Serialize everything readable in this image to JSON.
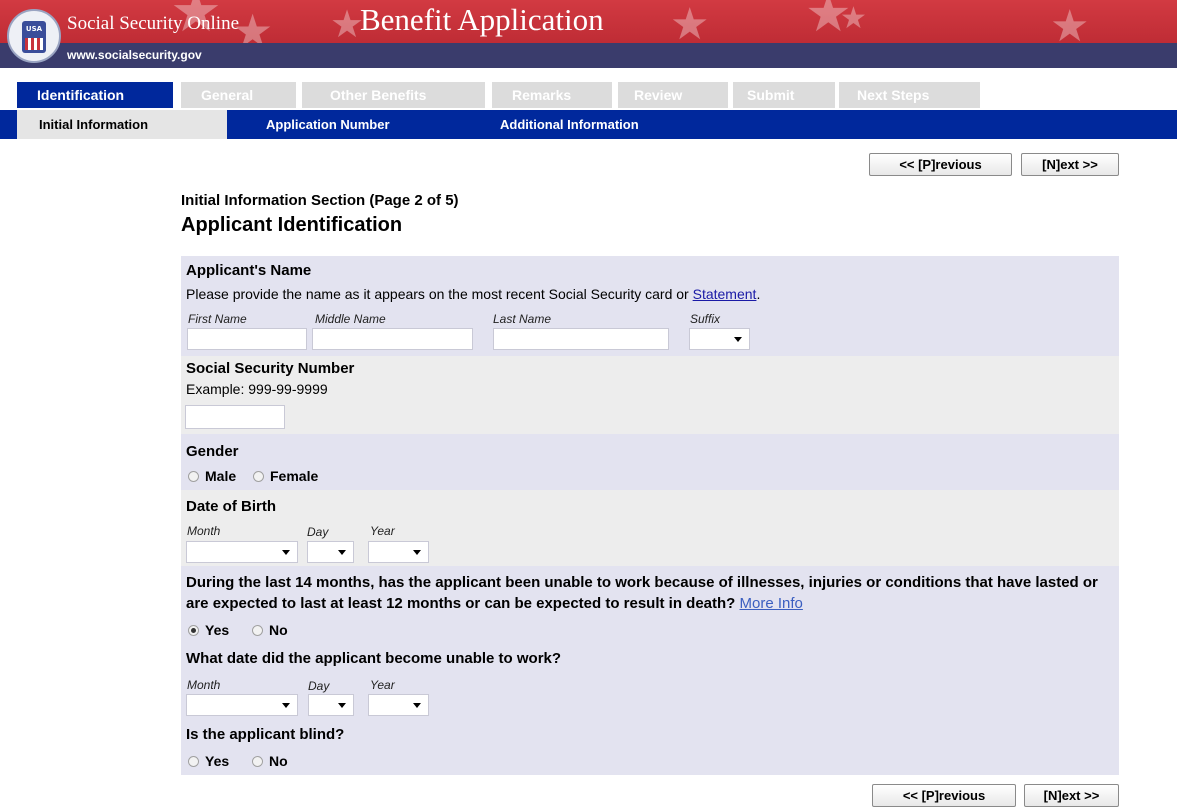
{
  "header": {
    "site_name": "Social Security Online",
    "site_url": "www.socialsecurity.gov",
    "app_title": "Benefit Application",
    "seal_text": "USA"
  },
  "tabs": [
    {
      "label": "Identification",
      "active": true
    },
    {
      "label": "General",
      "active": false
    },
    {
      "label": "Other Benefits",
      "active": false
    },
    {
      "label": "Remarks",
      "active": false
    },
    {
      "label": "Review",
      "active": false
    },
    {
      "label": "Submit",
      "active": false
    },
    {
      "label": "Next Steps",
      "active": false
    }
  ],
  "subnav": [
    {
      "label": "Initial Information",
      "active": true
    },
    {
      "label": "Application Number",
      "active": false
    },
    {
      "label": "Additional Information",
      "active": false
    }
  ],
  "nav_buttons": {
    "previous": "<< [P]revious",
    "next": "[N]ext >>"
  },
  "page": {
    "section_label": "Initial Information Section (Page 2 of 5)",
    "title": "Applicant Identification"
  },
  "name_section": {
    "title": "Applicant's Name",
    "hint_before": "Please provide the name as it appears on the most recent Social Security card or ",
    "hint_link": "Statement",
    "hint_after": ".",
    "first_label": "First Name",
    "first_value": "",
    "middle_label": "Middle Name",
    "middle_value": "",
    "last_label": "Last Name",
    "last_value": "",
    "suffix_label": "Suffix",
    "suffix_value": ""
  },
  "ssn_section": {
    "title": "Social Security Number",
    "example": "Example: 999-99-9999",
    "value": ""
  },
  "gender_section": {
    "title": "Gender",
    "male": "Male",
    "female": "Female",
    "selected": ""
  },
  "dob_section": {
    "title": "Date of Birth",
    "month_label": "Month",
    "day_label": "Day",
    "year_label": "Year"
  },
  "disability_section": {
    "question": "During the last 14 months, has the applicant been unable to work because of illnesses, injuries or conditions that have lasted or are expected to last at least 12 months or can be expected to result in death?",
    "more_info": "More Info",
    "yes": "Yes",
    "no": "No",
    "selected": "Yes"
  },
  "onset_section": {
    "title": "What date did the applicant become unable to work?",
    "month_label": "Month",
    "day_label": "Day",
    "year_label": "Year"
  },
  "blind_section": {
    "title": "Is the applicant blind?",
    "yes": "Yes",
    "no": "No",
    "selected": ""
  },
  "colors": {
    "banner_red": "#c8323c",
    "banner_navy": "#3a3c6c",
    "tab_blue": "#00289c",
    "panel_lavender": "#e3e3f0",
    "panel_gray": "#ededed"
  }
}
